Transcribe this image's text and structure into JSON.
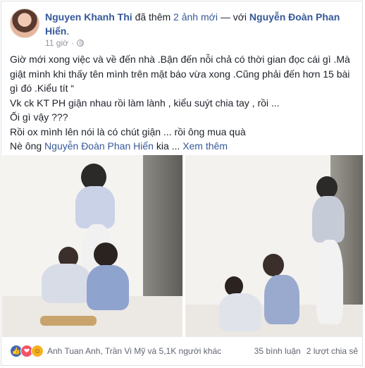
{
  "post": {
    "author": "Nguyen Khanh Thi",
    "action_text": "đã thêm",
    "photo_count_text": "2 ảnh mới",
    "with_text": "— với",
    "tagged_name": "Nguyễn Đoàn Phan Hiển",
    "time": "11 giờ",
    "lines": [
      "Giờ mới xong việc và về đến nhà .Bận đến nỗi chả có thời gian đọc cái gì .Mà giật mình khi thấy tên mình trên mặt báo vừa xong .Cũng phải đến hơn 15 bài gì đó .Kiểu tít “",
      "Vk ck KT PH giận nhau rồi làm lành , kiểu suýt chia tay , rồi ...",
      "Ối gì vậy ???",
      "Rồi ox mình lên nói là có chút giận ... rồi ông mua quà"
    ],
    "last_line_prefix": "Nè ông",
    "last_line_name": "Nguyễn Đoàn Phan Hiển",
    "last_line_suffix": "kia ...",
    "see_more": "Xem thêm"
  },
  "reactions": {
    "icons": [
      "like-icon",
      "love-icon",
      "haha-icon"
    ],
    "names": "Anh Tuan Anh, Trần Vi Mỹ và 5,1K người khác",
    "comments": "35 bình luận",
    "shares": "2 lượt chia sẻ"
  },
  "colors": {
    "link": "#365899",
    "meta": "#90949c",
    "text": "#1d2129"
  }
}
